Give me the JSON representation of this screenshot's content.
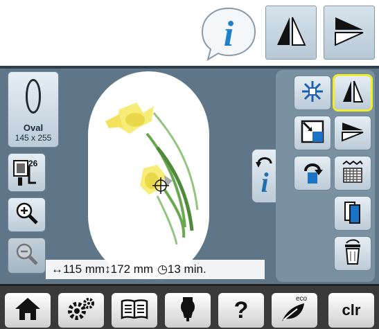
{
  "colors": {
    "accent_selected": "#f0ec32",
    "screen_bg": "#5e7687",
    "panel_bg": "#7a91a1",
    "bottom_bg": "#3a3a3a"
  },
  "hoop": {
    "name": "Oval",
    "size": "145 x 255"
  },
  "frame": {
    "number": "26"
  },
  "status": {
    "width": "115 mm",
    "height": "172 mm",
    "time": "13 min."
  },
  "bottom": {
    "clear_label": "clr",
    "help_label": "?",
    "eco_label": "eco"
  },
  "icons": {
    "top": [
      "info-bubble-icon",
      "mirror-horizontal-icon",
      "mirror-vertical-icon"
    ],
    "left": [
      "oval-hoop-icon",
      "embroidery-frame-icon",
      "zoom-in-icon",
      "zoom-out-icon"
    ],
    "right": [
      "center-icon",
      "mirror-horizontal-icon",
      "move-to-corner-icon",
      "mirror-vertical-icon",
      "rotate-icon",
      "pattern-fill-icon",
      "duplicate-icon",
      "delete-icon"
    ],
    "bottom": [
      "home-icon",
      "setup-icon",
      "tutorial-icon",
      "advisor-icon",
      "help-icon",
      "eco-icon",
      "clear-icon"
    ]
  }
}
